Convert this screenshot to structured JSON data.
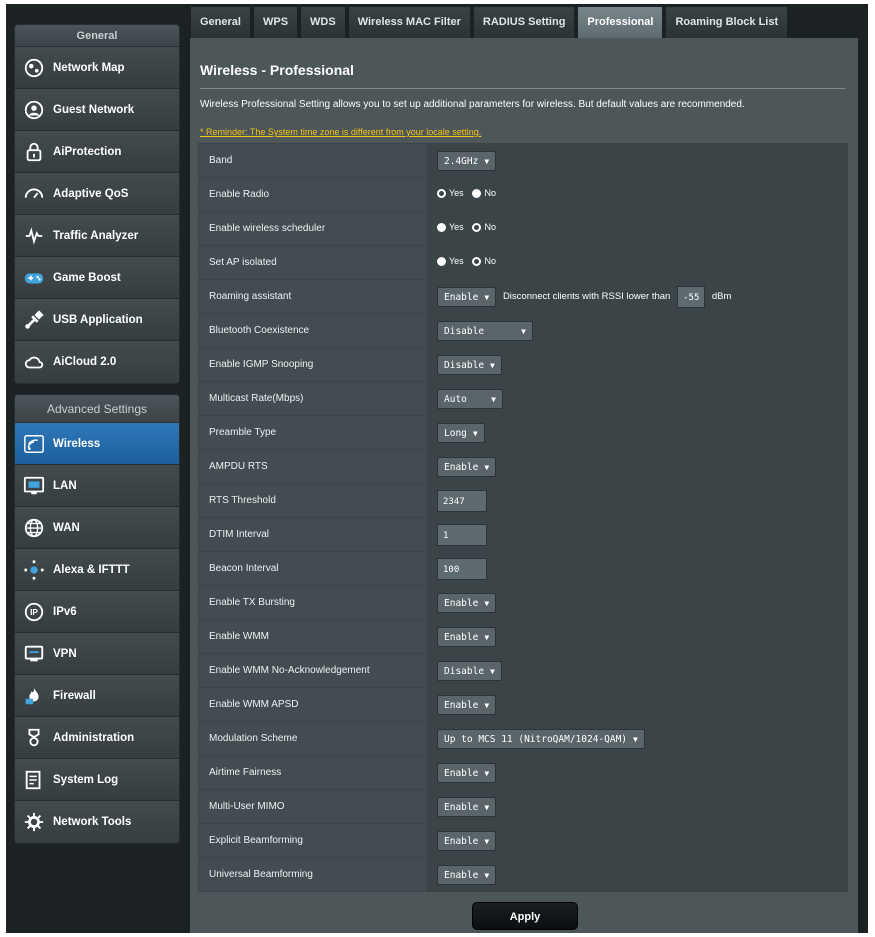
{
  "sidebar": {
    "general_header": "General",
    "general_items": [
      {
        "label": "Network Map",
        "icon": "network-map-icon"
      },
      {
        "label": "Guest Network",
        "icon": "guest-network-icon"
      },
      {
        "label": "AiProtection",
        "icon": "lock-icon"
      },
      {
        "label": "Adaptive QoS",
        "icon": "gauge-icon"
      },
      {
        "label": "Traffic Analyzer",
        "icon": "pulse-icon"
      },
      {
        "label": "Game Boost",
        "icon": "gamepad-icon"
      },
      {
        "label": "USB Application",
        "icon": "usb-icon"
      },
      {
        "label": "AiCloud 2.0",
        "icon": "cloud-icon"
      }
    ],
    "advanced_header": "Advanced Settings",
    "advanced_items": [
      {
        "label": "Wireless",
        "icon": "wifi-icon",
        "active": true
      },
      {
        "label": "LAN",
        "icon": "lan-icon"
      },
      {
        "label": "WAN",
        "icon": "globe-icon"
      },
      {
        "label": "Alexa & IFTTT",
        "icon": "alexa-icon"
      },
      {
        "label": "IPv6",
        "icon": "ipv6-icon"
      },
      {
        "label": "VPN",
        "icon": "vpn-icon"
      },
      {
        "label": "Firewall",
        "icon": "fire-icon"
      },
      {
        "label": "Administration",
        "icon": "admin-icon"
      },
      {
        "label": "System Log",
        "icon": "log-icon"
      },
      {
        "label": "Network Tools",
        "icon": "tools-icon"
      }
    ]
  },
  "tabs": [
    "General",
    "WPS",
    "WDS",
    "Wireless MAC Filter",
    "RADIUS Setting",
    "Professional",
    "Roaming Block List"
  ],
  "active_tab": "Professional",
  "page": {
    "title": "Wireless - Professional",
    "description": "Wireless Professional Setting allows you to set up additional parameters for wireless. But default values are recommended.",
    "reminder": "* Reminder: The System time zone is different from your locale setting."
  },
  "settings": {
    "band": {
      "label": "Band",
      "value": "2.4GHz"
    },
    "enable_radio": {
      "label": "Enable Radio",
      "yes": "Yes",
      "no": "No",
      "selected": "Yes"
    },
    "wireless_scheduler": {
      "label": "Enable wireless scheduler",
      "yes": "Yes",
      "no": "No",
      "selected": "No"
    },
    "ap_isolated": {
      "label": "Set AP isolated",
      "yes": "Yes",
      "no": "No",
      "selected": "No"
    },
    "roaming_assistant": {
      "label": "Roaming assistant",
      "value": "Enable",
      "text": "Disconnect clients with RSSI lower than",
      "rssi": "-55",
      "unit": "dBm"
    },
    "bluetooth_coexistence": {
      "label": "Bluetooth Coexistence",
      "value": "Disable"
    },
    "igmp_snooping": {
      "label": "Enable IGMP Snooping",
      "value": "Disable"
    },
    "multicast_rate": {
      "label": "Multicast Rate(Mbps)",
      "value": "Auto"
    },
    "preamble_type": {
      "label": "Preamble Type",
      "value": "Long"
    },
    "ampdu_rts": {
      "label": "AMPDU RTS",
      "value": "Enable"
    },
    "rts_threshold": {
      "label": "RTS Threshold",
      "value": "2347"
    },
    "dtim_interval": {
      "label": "DTIM Interval",
      "value": "1"
    },
    "beacon_interval": {
      "label": "Beacon Interval",
      "value": "100"
    },
    "tx_bursting": {
      "label": "Enable TX Bursting",
      "value": "Enable"
    },
    "wmm": {
      "label": "Enable WMM",
      "value": "Enable"
    },
    "wmm_no_ack": {
      "label": "Enable WMM No-Acknowledgement",
      "value": "Disable"
    },
    "wmm_apsd": {
      "label": "Enable WMM APSD",
      "value": "Enable"
    },
    "modulation_scheme": {
      "label": "Modulation Scheme",
      "value": "Up to MCS 11 (NitroQAM/1024-QAM)"
    },
    "airtime_fairness": {
      "label": "Airtime Fairness",
      "value": "Enable"
    },
    "mu_mimo": {
      "label": "Multi-User MIMO",
      "value": "Enable"
    },
    "explicit_beamforming": {
      "label": "Explicit Beamforming",
      "value": "Enable"
    },
    "universal_beamforming": {
      "label": "Universal Beamforming",
      "value": "Enable"
    }
  },
  "apply_label": "Apply"
}
